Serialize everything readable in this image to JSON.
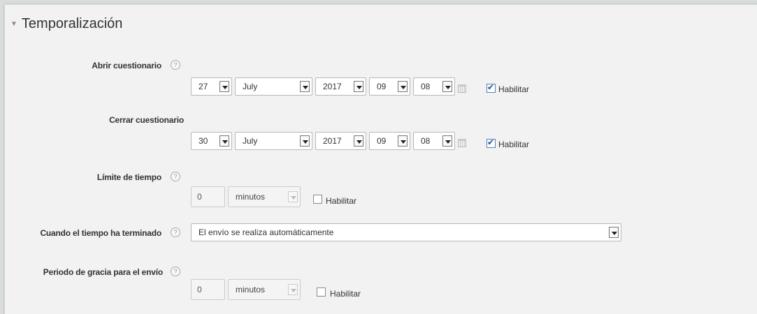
{
  "section": {
    "title": "Temporalización"
  },
  "open_quiz": {
    "label": "Abrir cuestionario",
    "day": "27",
    "month": "July",
    "year": "2017",
    "hour": "09",
    "minute": "08",
    "enable_label": "Habilitar",
    "enabled": true
  },
  "close_quiz": {
    "label": "Cerrar cuestionario",
    "day": "30",
    "month": "July",
    "year": "2017",
    "hour": "09",
    "minute": "08",
    "enable_label": "Habilitar",
    "enabled": true
  },
  "time_limit": {
    "label": "Límite de tiempo",
    "value": "0",
    "unit": "minutos",
    "enable_label": "Habilitar",
    "enabled": false
  },
  "when_time_ends": {
    "label": "Cuando el tiempo ha terminado",
    "value": "El envío se realiza automáticamente"
  },
  "grace_period": {
    "label": "Periodo de gracia para el envío",
    "value": "0",
    "unit": "minutos",
    "enable_label": "Habilitar",
    "enabled": false
  },
  "icons": {
    "help": "question-circle-icon",
    "calendar": "calendar-icon",
    "collapse": "caret-down-icon"
  }
}
